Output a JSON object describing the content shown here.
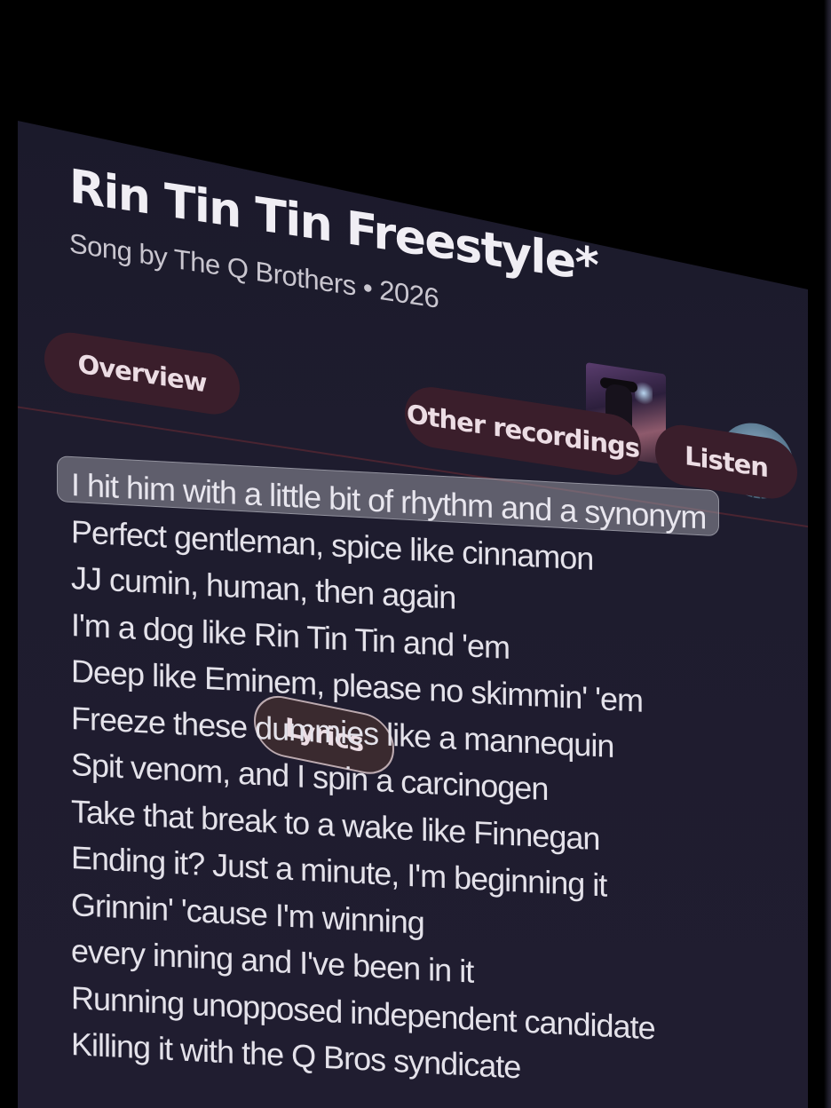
{
  "song": {
    "title": "Rin Tin Tin Freestyle*",
    "subtitle": "Song by The Q Brothers • 2026"
  },
  "tabs": [
    {
      "label": "Overview",
      "selected": false
    },
    {
      "label": "Lyrics",
      "selected": true
    },
    {
      "label": "Other recordings",
      "selected": false
    },
    {
      "label": "Listen",
      "selected": false
    }
  ],
  "lyrics": {
    "current_line_index": 0,
    "lines": [
      "I hit him with a little bit of rhythm and a synonym",
      "Perfect gentleman, spice like cinnamon",
      "JJ cumin, human, then again",
      "I'm a dog like Rin Tin Tin and 'em",
      "Deep like Eminem, please no skimmin' 'em",
      "Freeze these dummies like a mannequin",
      "Spit venom, and I spin a carcinogen",
      "Take that break to a wake like Finnegan",
      "Ending it? Just a minute, I'm beginning it",
      "Grinnin' 'cause I'm winning",
      "every inning and I've been in it",
      "Running unopposed independent candidate",
      "Killing it with the Q Bros syndicate"
    ]
  },
  "colors": {
    "background": "#000000",
    "panel": "#1e1c2e",
    "tab": "#3a1e2b",
    "text": "#e4e2ea",
    "highlight": "#8a8a94"
  },
  "icons": {
    "thumbnail": "album-thumbnail-image",
    "avatar": "artist-avatar-image"
  }
}
